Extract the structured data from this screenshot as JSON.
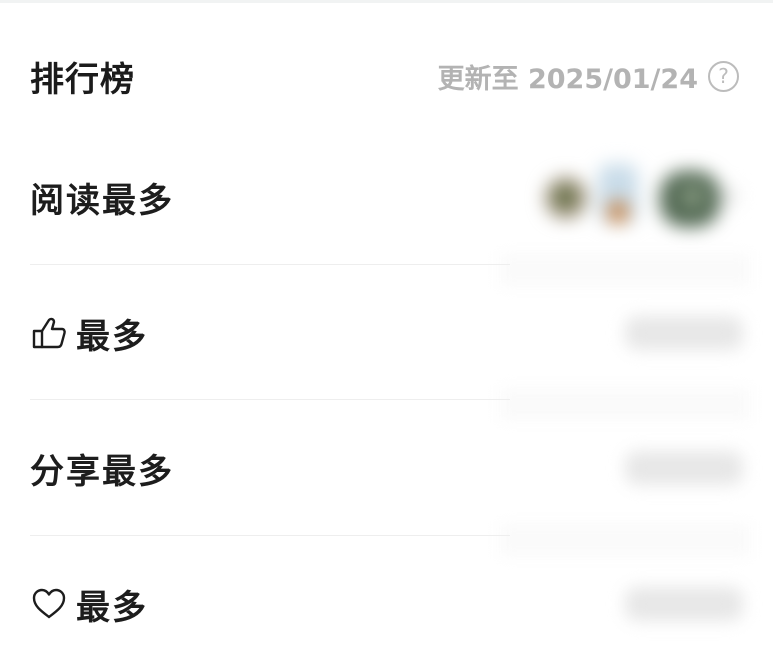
{
  "header": {
    "title": "排行榜",
    "update_text": "更新至 2025/01/24",
    "help_symbol": "?"
  },
  "rows": [
    {
      "label": "阅读最多",
      "icon": ""
    },
    {
      "label": "最多",
      "icon": "thumbs-up-icon"
    },
    {
      "label": "分享最多",
      "icon": ""
    },
    {
      "label": "最多",
      "icon": "heart-icon"
    }
  ],
  "colors": {
    "title": "#1b1b1b",
    "muted": "#b3b3b3",
    "divider": "#eeeeee",
    "background": "#ffffff"
  }
}
